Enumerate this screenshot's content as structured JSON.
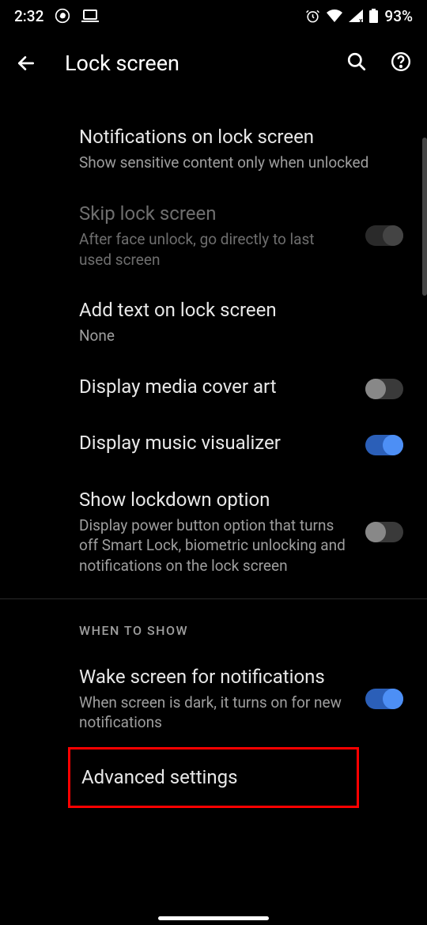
{
  "status": {
    "time": "2:32",
    "battery": "93%"
  },
  "header": {
    "title": "Lock screen"
  },
  "settings": {
    "notifications": {
      "title": "Notifications on lock screen",
      "subtitle": "Show sensitive content only when unlocked"
    },
    "skip": {
      "title": "Skip lock screen",
      "subtitle": "After face unlock, go directly to last used screen"
    },
    "addText": {
      "title": "Add text on lock screen",
      "subtitle": "None"
    },
    "mediaCover": {
      "title": "Display media cover art"
    },
    "musicViz": {
      "title": "Display music visualizer"
    },
    "lockdown": {
      "title": "Show lockdown option",
      "subtitle": "Display power button option that turns off Smart Lock, biometric unlocking and notifications on the lock screen"
    },
    "sectionHeader": "WHEN TO SHOW",
    "wakeScreen": {
      "title": "Wake screen for notifications",
      "subtitle": "When screen is dark, it turns on for new notifications"
    },
    "advanced": {
      "title": "Advanced settings"
    }
  }
}
